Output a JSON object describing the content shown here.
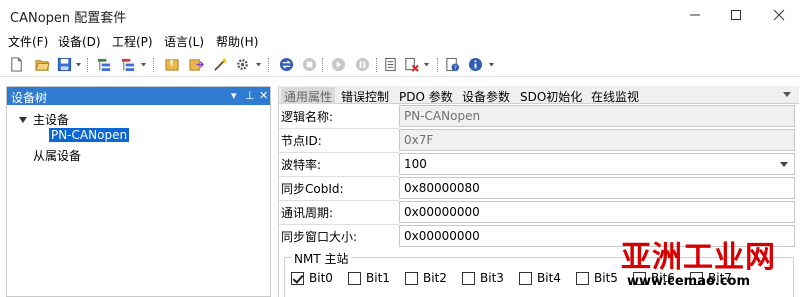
{
  "window": {
    "title": "CANopen 配置套件"
  },
  "menu": [
    "文件(F)",
    "设备(D)",
    "工程(P)",
    "语言(L)",
    "帮助(H)"
  ],
  "device_tree": {
    "title": "设备树",
    "pin_glyph": "▾ ꟼ ✕",
    "master_label": "主设备",
    "master_child": "PN-CANopen",
    "slave_label": "从属设备"
  },
  "tabs": [
    "通用属性",
    "错误控制",
    "PDO 参数",
    "设备参数",
    "SDO初始化",
    "在线监视"
  ],
  "properties": [
    {
      "label": "逻辑名称:",
      "value": "PN-CANopen",
      "readonly": true
    },
    {
      "label": "节点ID:",
      "value": "0x7F",
      "readonly": true
    },
    {
      "label": "波特率:",
      "value": "100",
      "dropdown": true
    },
    {
      "label": "同步CobId:",
      "value": "0x80000080"
    },
    {
      "label": "通讯周期:",
      "value": "0x00000000"
    },
    {
      "label": "同步窗口大小:",
      "value": "0x00000000"
    }
  ],
  "nmt": {
    "title": "NMT 主站",
    "bits": [
      {
        "label": "Bit0",
        "checked": true
      },
      {
        "label": "Bit1",
        "checked": false
      },
      {
        "label": "Bit2",
        "checked": false
      },
      {
        "label": "Bit3",
        "checked": false
      },
      {
        "label": "Bit4",
        "checked": false
      },
      {
        "label": "Bit5",
        "checked": false
      },
      {
        "label": "Bit6",
        "checked": false
      },
      {
        "label": "Bit7",
        "checked": false
      }
    ]
  },
  "watermark": {
    "main": "亚洲工业网",
    "url": "www.cemao.com"
  }
}
